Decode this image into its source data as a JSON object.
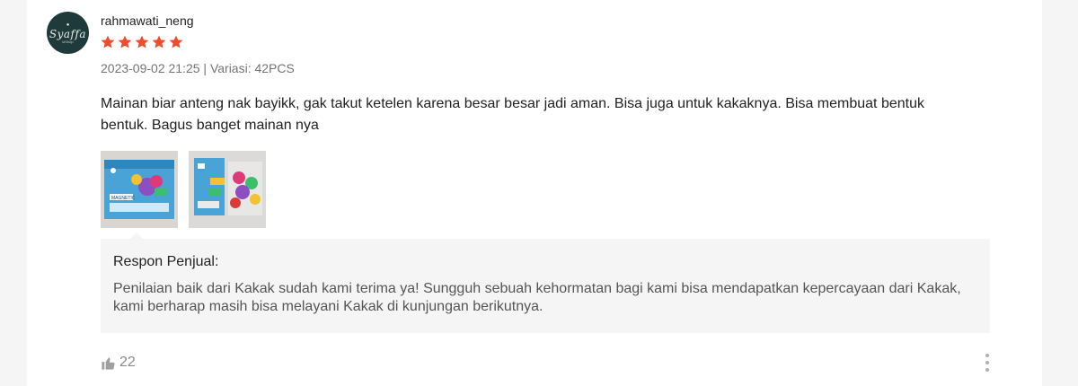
{
  "review": {
    "username": "rahmawati_neng",
    "avatar": {
      "script_text": "Syaffa",
      "sub_text": "kiShop",
      "background": "#1f3a3a"
    },
    "rating": 5,
    "rating_max": 5,
    "star_color": "#ee4d2d",
    "meta": "2023-09-02 21:25 | Variasi: 42PCS",
    "text": "Mainan biar anteng nak bayikk, gak takut ketelen karena besar besar jadi aman. Bisa juga untuk kakaknya. Bisa membuat bentuk bentuk. Bagus banget mainan nya",
    "photos": [
      {
        "icon": "product-box-photo",
        "label": "MAGNETIC"
      },
      {
        "icon": "magnetic-pieces-photo",
        "label": ""
      }
    ]
  },
  "seller_response": {
    "title": "Respon Penjual:",
    "text": "Penilaian baik dari Kakak sudah kami terima ya! Sungguh sebuah kehormatan bagi kami bisa mendapatkan kepercayaan dari Kakak, kami berharap masih bisa melayani Kakak di kunjungan berikutnya."
  },
  "footer": {
    "like_icon": "thumbs-up-icon",
    "like_count": "22",
    "more_icon": "more-vertical-icon"
  }
}
